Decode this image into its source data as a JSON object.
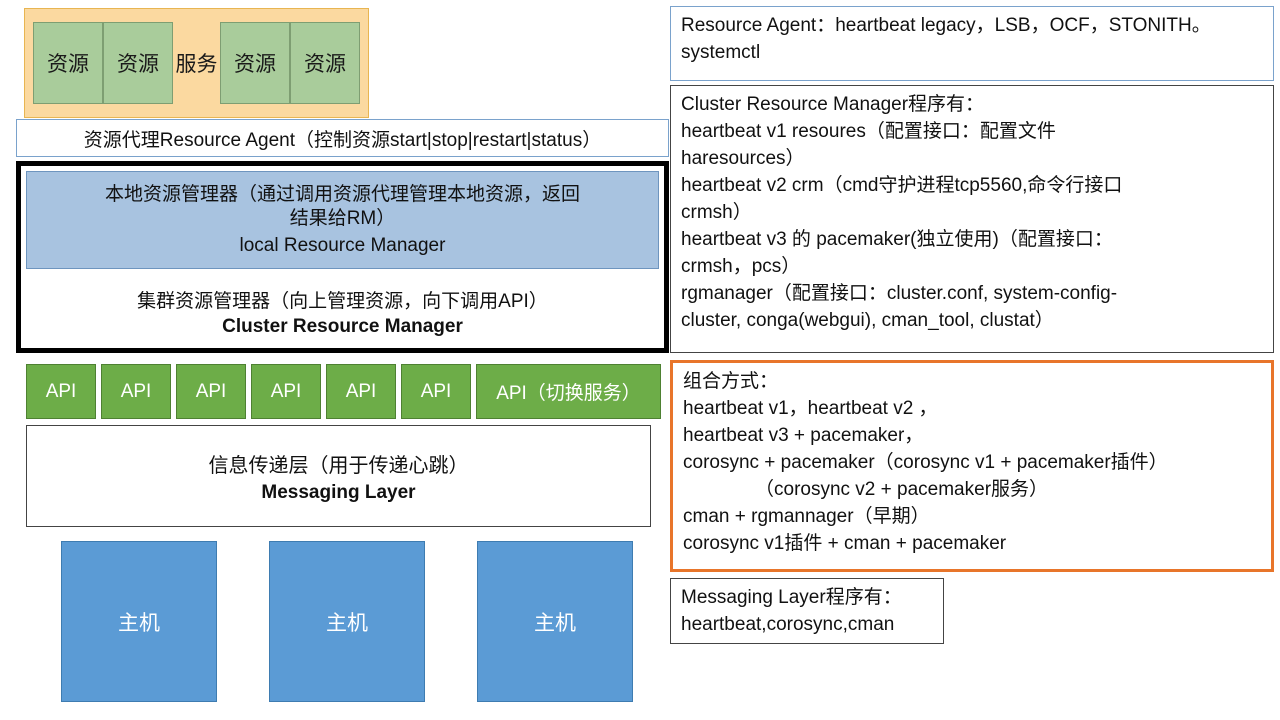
{
  "left": {
    "service_container": {
      "name": "service-resource-group",
      "service_label": "服务",
      "resources_left": [
        "资源",
        "资源"
      ],
      "resources_right": [
        "资源",
        "资源"
      ],
      "fill_color": "#FBD9A0",
      "resource_color": "#A9CC9B"
    },
    "resource_agent_bar": {
      "text": "资源代理Resource Agent（控制资源start|stop|restart|status）"
    },
    "crm_block": {
      "local_rm": {
        "cn_line1": "本地资源管理器（通过调用资源代理管理本地资源，返回",
        "cn_line2": "结果给RM）",
        "en": "local Resource Manager",
        "fill_color": "#A8C3E0"
      },
      "cluster_rm": {
        "cn": "集群资源管理器（向上管理资源，向下调用API）",
        "en": "Cluster Resource Manager"
      }
    },
    "api_row": {
      "items": [
        "API",
        "API",
        "API",
        "API",
        "API",
        "API"
      ],
      "wide_item": "API（切换服务）",
      "fill_color": "#6DAD48"
    },
    "messaging_box": {
      "cn": "信息传递层（用于传递心跳）",
      "en": "Messaging Layer"
    },
    "host_row": {
      "items": [
        "主机",
        "主机",
        "主机"
      ],
      "fill_color": "#5B9BD5"
    }
  },
  "right": {
    "resource_agent_panel": {
      "lines": [
        "Resource Agent：heartbeat legacy，LSB，OCF，STONITH。",
        "systemctl"
      ],
      "border_color": "#7AA2CC"
    },
    "crm_panel": {
      "lines": [
        "Cluster Resource Manager程序有：",
        "heartbeat v1 resoures（配置接口：配置文件",
        "haresources）",
        "heartbeat v2 crm（cmd守护进程tcp5560,命令行接口",
        "crmsh）",
        "heartbeat v3 的 pacemaker(独立使用)（配置接口：",
        "crmsh，pcs）",
        "rgmanager（配置接口：cluster.conf, system-config-",
        "cluster, conga(webgui), cman_tool, clustat）"
      ],
      "border_color": "#444444"
    },
    "combination_panel": {
      "lines": [
        "组合方式：",
        "heartbeat v1，heartbeat v2 ，",
        "heartbeat v3 + pacemaker，",
        "corosync + pacemaker（corosync v1 + pacemaker插件）",
        "（corosync v2 + pacemaker服务）",
        "cman + rgmannager（早期）",
        "corosync v1插件 + cman + pacemaker"
      ],
      "indent_line_index": 4,
      "border_color": "#E8752A"
    },
    "messaging_panel": {
      "lines": [
        "Messaging Layer程序有：",
        "heartbeat,corosync,cman"
      ],
      "border_color": "#444444"
    }
  }
}
